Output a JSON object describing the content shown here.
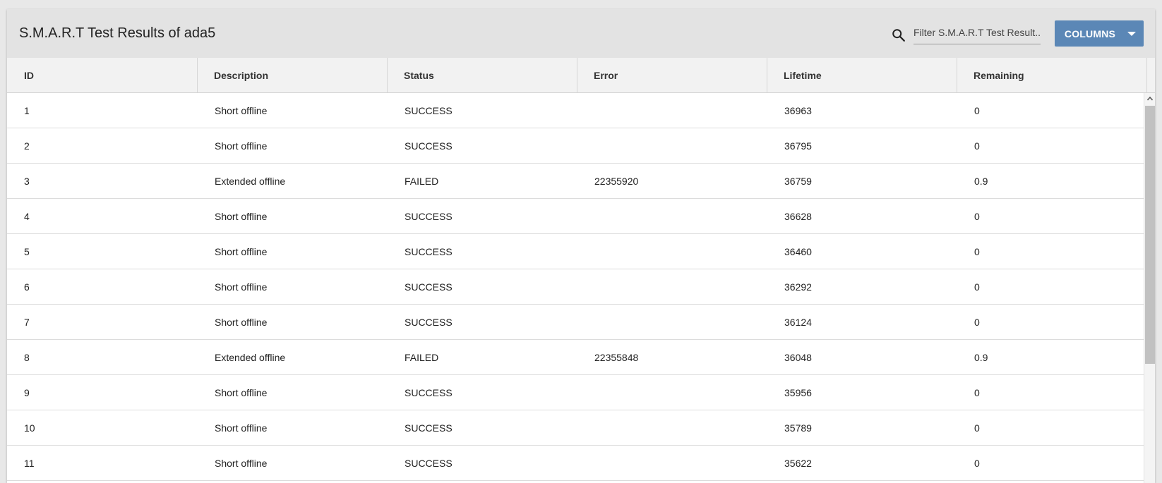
{
  "header": {
    "title": "S.M.A.R.T Test Results of ada5",
    "filter_placeholder": "Filter S.M.A.R.T Test Result...",
    "columns_label": "COLUMNS"
  },
  "table": {
    "columns": [
      "ID",
      "Description",
      "Status",
      "Error",
      "Lifetime",
      "Remaining"
    ],
    "rows": [
      [
        "1",
        "Short offline",
        "SUCCESS",
        "",
        "36963",
        "0"
      ],
      [
        "2",
        "Short offline",
        "SUCCESS",
        "",
        "36795",
        "0"
      ],
      [
        "3",
        "Extended offline",
        "FAILED",
        "22355920",
        "36759",
        "0.9"
      ],
      [
        "4",
        "Short offline",
        "SUCCESS",
        "",
        "36628",
        "0"
      ],
      [
        "5",
        "Short offline",
        "SUCCESS",
        "",
        "36460",
        "0"
      ],
      [
        "6",
        "Short offline",
        "SUCCESS",
        "",
        "36292",
        "0"
      ],
      [
        "7",
        "Short offline",
        "SUCCESS",
        "",
        "36124",
        "0"
      ],
      [
        "8",
        "Extended offline",
        "FAILED",
        "22355848",
        "36048",
        "0.9"
      ],
      [
        "9",
        "Short offline",
        "SUCCESS",
        "",
        "35956",
        "0"
      ],
      [
        "10",
        "Short offline",
        "SUCCESS",
        "",
        "35789",
        "0"
      ],
      [
        "11",
        "Short offline",
        "SUCCESS",
        "",
        "35622",
        "0"
      ]
    ]
  },
  "colors": {
    "accent": "#5b87b6",
    "header_bg": "#e3e3e3",
    "table_header_bg": "#f2f2f2"
  }
}
